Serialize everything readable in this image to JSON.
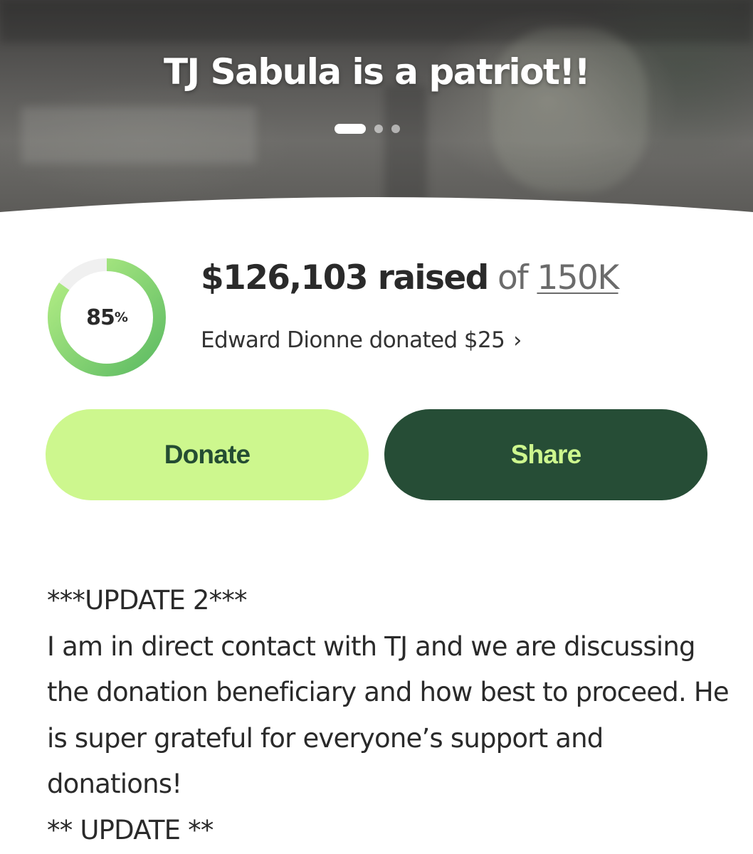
{
  "hero": {
    "title": "TJ Sabula is a patriot!!",
    "carousel": {
      "slides": 3,
      "active_index": 0
    }
  },
  "progress": {
    "percent_value": 85,
    "percent_number": "85",
    "percent_sign": "%",
    "raised_amount": "$126,103 raised",
    "of_text": "of",
    "goal": "150K",
    "recent_donation": "Edward Dionne donated $25",
    "recent_donation_icon": "chevron-right-icon",
    "ring_colors": {
      "track": "#f0f0f0",
      "fill_start": "#5dbb63",
      "fill_end": "#b6ef86"
    }
  },
  "actions": {
    "donate_label": "Donate",
    "share_label": "Share",
    "colors": {
      "donate_bg": "#cdf78e",
      "donate_text": "#244d33",
      "share_bg": "#264d36",
      "share_text": "#cdf78e"
    }
  },
  "story": {
    "lines": [
      "***UPDATE 2***",
      "I am in direct contact with TJ and we are discussing the donation beneficiary and how best to proceed. He is super grateful for everyone’s support and donations!",
      "** UPDATE **"
    ]
  }
}
